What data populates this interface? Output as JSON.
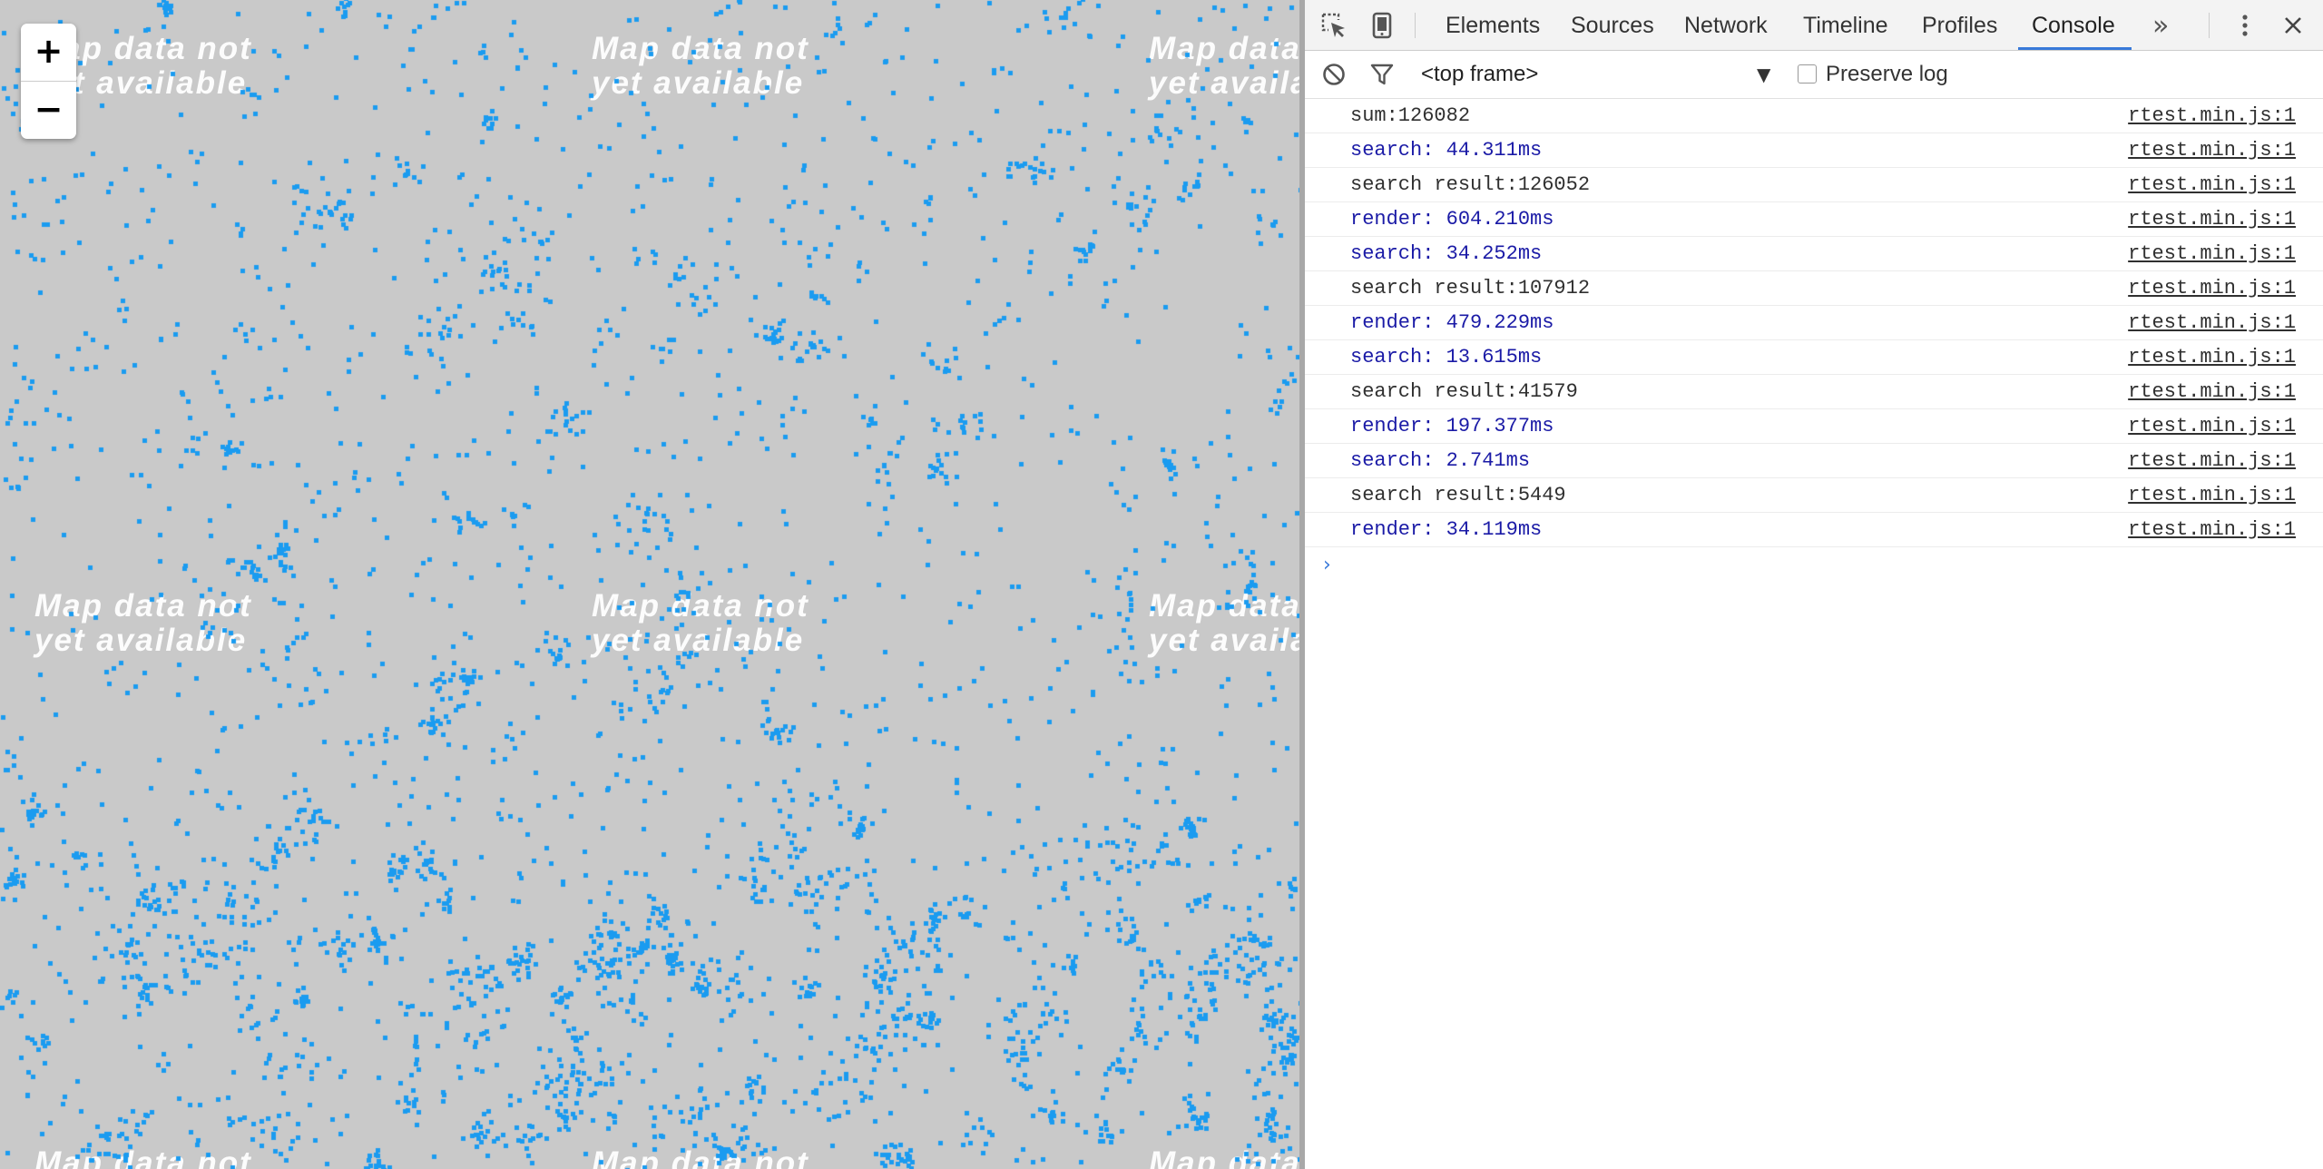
{
  "map": {
    "placeholder_line1": "Map data not",
    "placeholder_line2": "yet available",
    "point_color": "#1a9bf0",
    "zoom_in_label": "+",
    "zoom_out_label": "−"
  },
  "devtools": {
    "tabs": [
      {
        "label": "Elements",
        "active": false
      },
      {
        "label": "Sources",
        "active": false
      },
      {
        "label": "Network",
        "active": false
      },
      {
        "label": "Timeline",
        "active": false
      },
      {
        "label": "Profiles",
        "active": false
      },
      {
        "label": "Console",
        "active": true
      }
    ],
    "more_tabs_label": "»",
    "accent_color": "#3879d9",
    "console_bar": {
      "frame": "<top frame>",
      "frame_arrow": "▼",
      "preserve_log_label": "Preserve log",
      "preserve_log_checked": false
    },
    "messages": [
      {
        "text": "sum:126082",
        "level": "log",
        "source": "rtest.min.js:1"
      },
      {
        "text": "search: 44.311ms",
        "level": "debug",
        "source": "rtest.min.js:1"
      },
      {
        "text": "search result:126052",
        "level": "log",
        "source": "rtest.min.js:1"
      },
      {
        "text": "render: 604.210ms",
        "level": "debug",
        "source": "rtest.min.js:1"
      },
      {
        "text": "search: 34.252ms",
        "level": "debug",
        "source": "rtest.min.js:1"
      },
      {
        "text": "search result:107912",
        "level": "log",
        "source": "rtest.min.js:1"
      },
      {
        "text": "render: 479.229ms",
        "level": "debug",
        "source": "rtest.min.js:1"
      },
      {
        "text": "search: 13.615ms",
        "level": "debug",
        "source": "rtest.min.js:1"
      },
      {
        "text": "search result:41579",
        "level": "log",
        "source": "rtest.min.js:1"
      },
      {
        "text": "render: 197.377ms",
        "level": "debug",
        "source": "rtest.min.js:1"
      },
      {
        "text": "search: 2.741ms",
        "level": "debug",
        "source": "rtest.min.js:1"
      },
      {
        "text": "search result:5449",
        "level": "log",
        "source": "rtest.min.js:1"
      },
      {
        "text": "render: 34.119ms",
        "level": "debug",
        "source": "rtest.min.js:1"
      }
    ],
    "prompt_symbol": "›"
  }
}
